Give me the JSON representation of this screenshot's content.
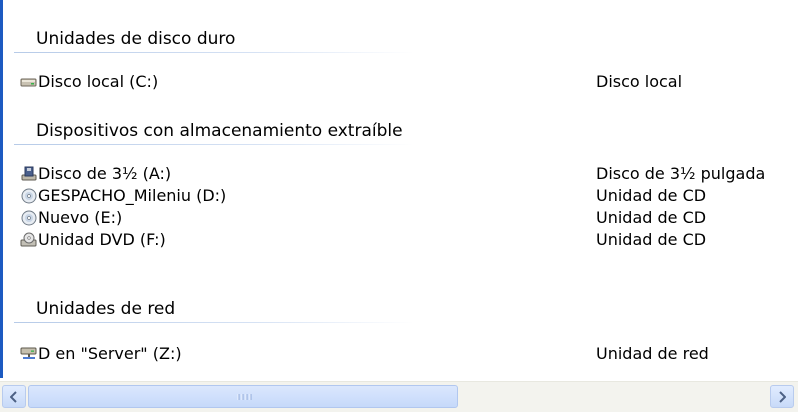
{
  "groups": [
    {
      "title": "Unidades de disco duro",
      "items": [
        {
          "name": "Disco local (C:)",
          "type": "Disco local",
          "icon": "hard-drive-icon"
        }
      ]
    },
    {
      "title": "Dispositivos con almacenamiento extraíble",
      "items": [
        {
          "name": "Disco de 3½ (A:)",
          "type": "Disco de 3½ pulgada",
          "icon": "floppy-drive-icon"
        },
        {
          "name": "GESPACHO_Mileniu (D:)",
          "type": "Unidad de CD",
          "icon": "cd-drive-icon"
        },
        {
          "name": "Nuevo (E:)",
          "type": "Unidad de CD",
          "icon": "cd-drive-icon"
        },
        {
          "name": "Unidad DVD (F:)",
          "type": "Unidad de CD",
          "icon": "dvd-drive-icon"
        }
      ]
    },
    {
      "title": "Unidades de red",
      "items": [
        {
          "name": "D en \"Server\" (Z:)",
          "type": "Unidad de red",
          "icon": "network-drive-icon"
        }
      ]
    }
  ],
  "scrollbar": {
    "thumb_fraction": 0.58,
    "position": 0
  },
  "colors": {
    "accent": "#1c5ac1",
    "scroll_thumb": "#c6d9fa"
  }
}
